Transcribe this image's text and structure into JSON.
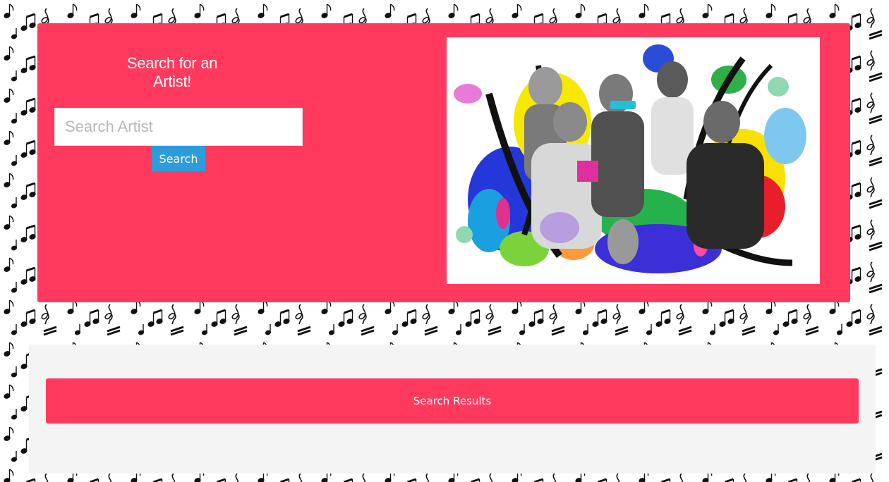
{
  "hero": {
    "title": "Search for an Artist!",
    "image_alt": "collage of latin music artists"
  },
  "search": {
    "placeholder": "Search Artist",
    "value": "",
    "button_label": "Search"
  },
  "results": {
    "header_label": "Search Results"
  },
  "colors": {
    "accent_pink": "#ff3a5e",
    "button_blue": "#2d9cdb",
    "panel_gray": "#f4f4f4"
  }
}
